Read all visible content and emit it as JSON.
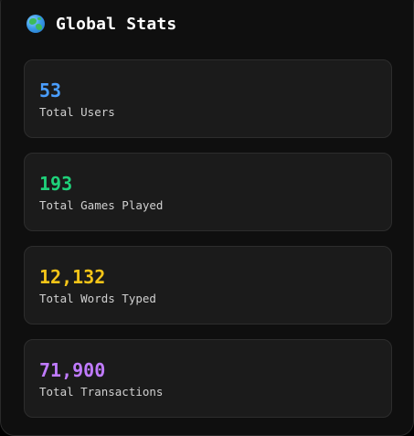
{
  "header": {
    "icon": "globe-icon",
    "title": "Global Stats"
  },
  "stats": [
    {
      "value": "53",
      "label": "Total Users",
      "color": "#4a9eff"
    },
    {
      "value": "193",
      "label": "Total Games Played",
      "color": "#1fd17a"
    },
    {
      "value": "12,132",
      "label": "Total Words Typed",
      "color": "#f5c518"
    },
    {
      "value": "71,900",
      "label": "Total Transactions",
      "color": "#c07bff"
    }
  ]
}
